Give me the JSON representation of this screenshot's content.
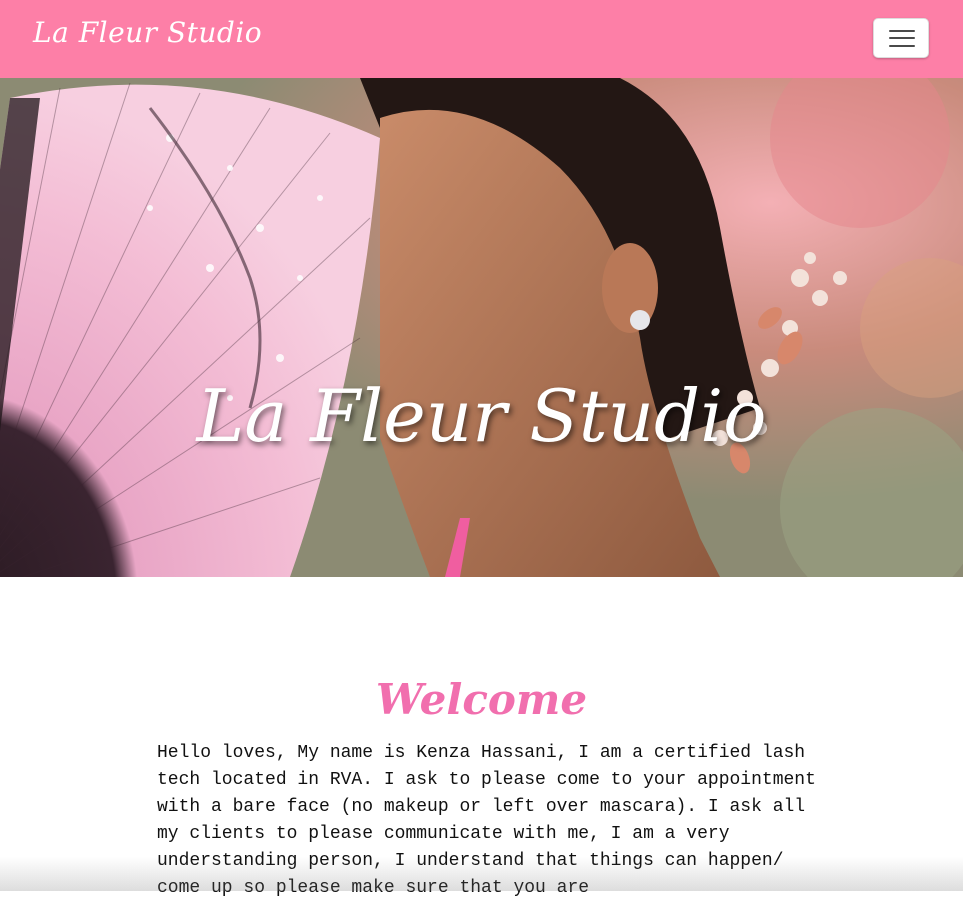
{
  "nav": {
    "brand": "La Fleur Studio",
    "toggle_icon": "hamburger-menu-icon",
    "background_color": "#fd7fa7"
  },
  "hero": {
    "image_alt": "Woman holding a pink floral hand fan with pearl hair accessory",
    "title": "La Fleur Studio"
  },
  "welcome": {
    "heading": "Welcome",
    "heading_color": "#f16fae",
    "text": "Hello loves, My name is Kenza Hassani, I am a certified lash tech located in RVA. I ask to please come to your appointment with a bare face (no makeup or left over mascara). I ask all my clients to please communicate with me, I am a very understanding person, I understand that things can happen/ come up so please make sure that you are"
  }
}
